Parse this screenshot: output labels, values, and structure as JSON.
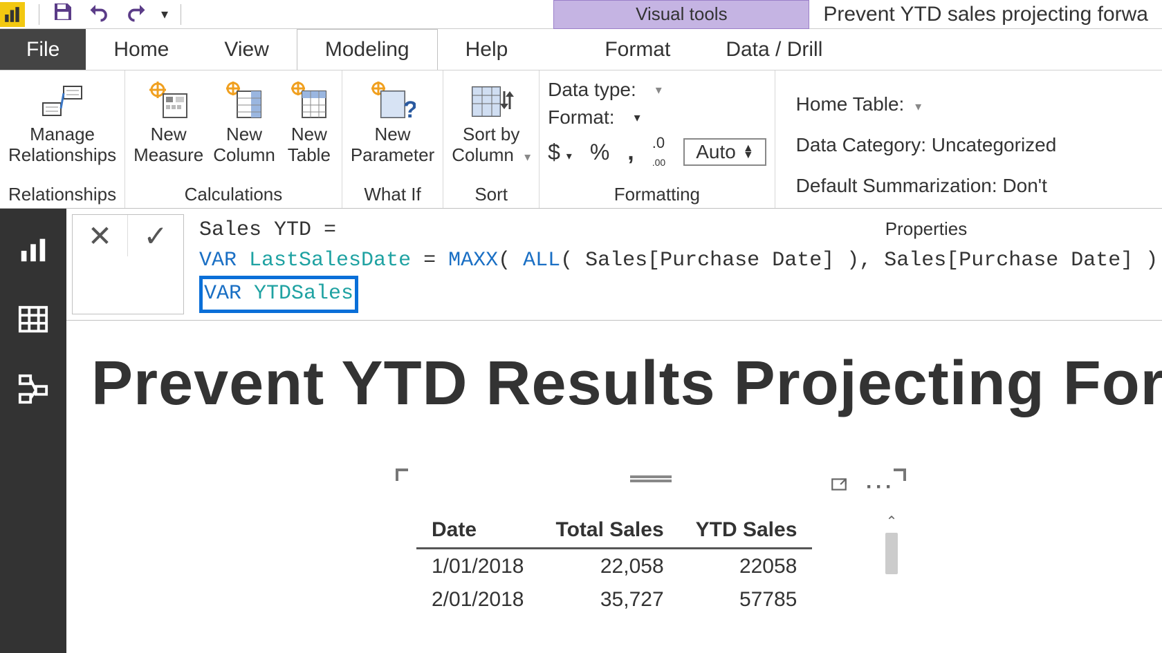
{
  "app": {
    "contextual_tab": "Visual tools",
    "doc_title": "Prevent YTD sales projecting forwa"
  },
  "tabs": {
    "file": "File",
    "home": "Home",
    "view": "View",
    "modeling": "Modeling",
    "help": "Help",
    "format": "Format",
    "datadrill": "Data / Drill"
  },
  "ribbon": {
    "relationships_group": "Relationships",
    "manage_relationships": "Manage\nRelationships",
    "calculations_group": "Calculations",
    "new_measure": "New\nMeasure",
    "new_column": "New\nColumn",
    "new_table": "New\nTable",
    "whatif_group": "What If",
    "new_parameter": "New\nParameter",
    "sort_group": "Sort",
    "sort_by_column": "Sort by\nColumn",
    "formatting_group": "Formatting",
    "data_type": "Data type:",
    "format": "Format:",
    "auto": "Auto",
    "properties_group": "Properties",
    "home_table": "Home Table:",
    "data_category": "Data Category: Uncategorized",
    "default_summarization": "Default Summarization: Don't"
  },
  "formula": {
    "line1_plain": "Sales YTD =",
    "line2": {
      "kw1": "VAR",
      "name1": "LastSalesDate",
      "eq": " = ",
      "fn1": "MAXX",
      "paren1": "( ",
      "fn2": "ALL",
      "rest": "( Sales[Purchase Date] ), Sales[Purchase Date] )"
    },
    "line3": {
      "kw": "VAR",
      "name": "YTDSales"
    }
  },
  "page": {
    "title": "Prevent YTD Results Projecting Forw"
  },
  "table": {
    "headers": {
      "c1": "Date",
      "c2": "Total Sales",
      "c3": "YTD Sales"
    },
    "rows": [
      {
        "date": "1/01/2018",
        "total": "22,058",
        "ytd": "22058"
      },
      {
        "date": "2/01/2018",
        "total": "35,727",
        "ytd": "57785"
      }
    ]
  },
  "icons": {
    "currency": "$",
    "percent": "%",
    "comma": ",",
    "decimals": ".00"
  }
}
